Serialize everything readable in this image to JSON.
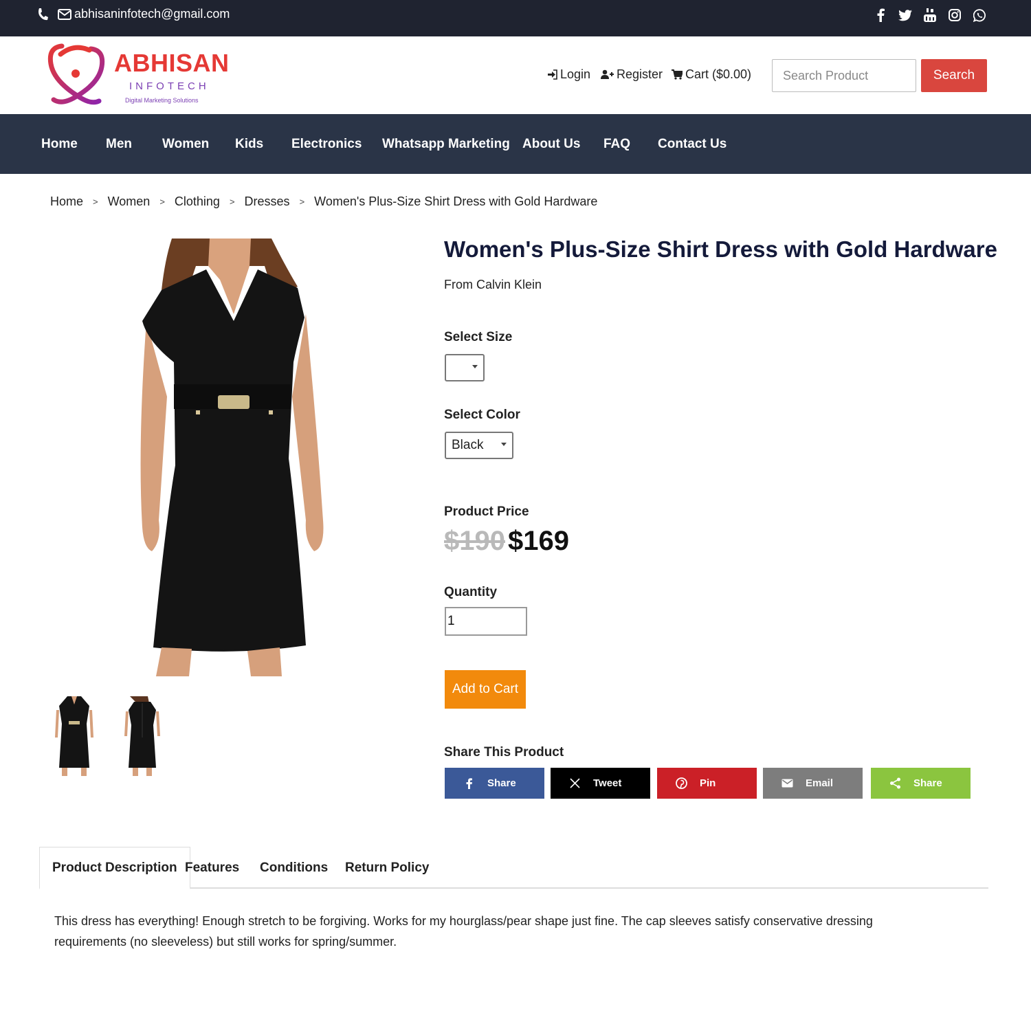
{
  "topbar": {
    "email": "abhisaninfotech@gmail.com",
    "social_icons": [
      "facebook-icon",
      "twitter-icon",
      "youtube-icon",
      "instagram-icon",
      "whatsapp-icon"
    ]
  },
  "header": {
    "logo_brand": "ABHISAN",
    "logo_sub": "INFOTECH",
    "logo_tag": "Digital Marketing Solutions",
    "login": "Login",
    "register": "Register",
    "cart": "Cart ($0.00)",
    "search_placeholder": "Search Product",
    "search_button": "Search"
  },
  "nav": {
    "items": [
      "Home",
      "Men",
      "Women",
      "Kids",
      "Electronics",
      "Whatsapp Marketing",
      "About Us",
      "FAQ",
      "Contact Us"
    ]
  },
  "breadcrumb": [
    "Home",
    "Women",
    "Clothing",
    "Dresses",
    "Women's Plus-Size Shirt Dress with Gold Hardware"
  ],
  "product": {
    "title": "Women's Plus-Size Shirt Dress with Gold Hardware",
    "brand": "From Calvin Klein",
    "size_label": "Select Size",
    "size_value": "",
    "color_label": "Select Color",
    "color_value": "Black",
    "price_label": "Product Price",
    "old_price": "$190",
    "new_price": "$169",
    "quantity_label": "Quantity",
    "quantity": "1",
    "add_to_cart": "Add to Cart",
    "share_label": "Share This Product"
  },
  "share": [
    {
      "label": "Share",
      "icon": "facebook-icon",
      "color": "#3b5998"
    },
    {
      "label": "Tweet",
      "icon": "x-icon",
      "color": "#000000"
    },
    {
      "label": "Pin",
      "icon": "pinterest-icon",
      "color": "#cb2027"
    },
    {
      "label": "Email",
      "icon": "email-icon",
      "color": "#7d7d7d"
    },
    {
      "label": "Share",
      "icon": "share-icon",
      "color": "#8bc53f"
    }
  ],
  "tabs": [
    "Product Description",
    "Features",
    "Conditions",
    "Return Policy"
  ],
  "description": "This dress has everything! Enough stretch to be forgiving. Works for my hourglass/pear shape just fine. The cap sleeves satisfy conservative dressing requirements (no sleeveless) but still works for spring/summer.",
  "colors": {
    "topbar": "#1f2330",
    "nav": "#2a3447",
    "search_button": "#d9463e",
    "add_to_cart": "#f28a0c",
    "title": "#141a3a"
  }
}
